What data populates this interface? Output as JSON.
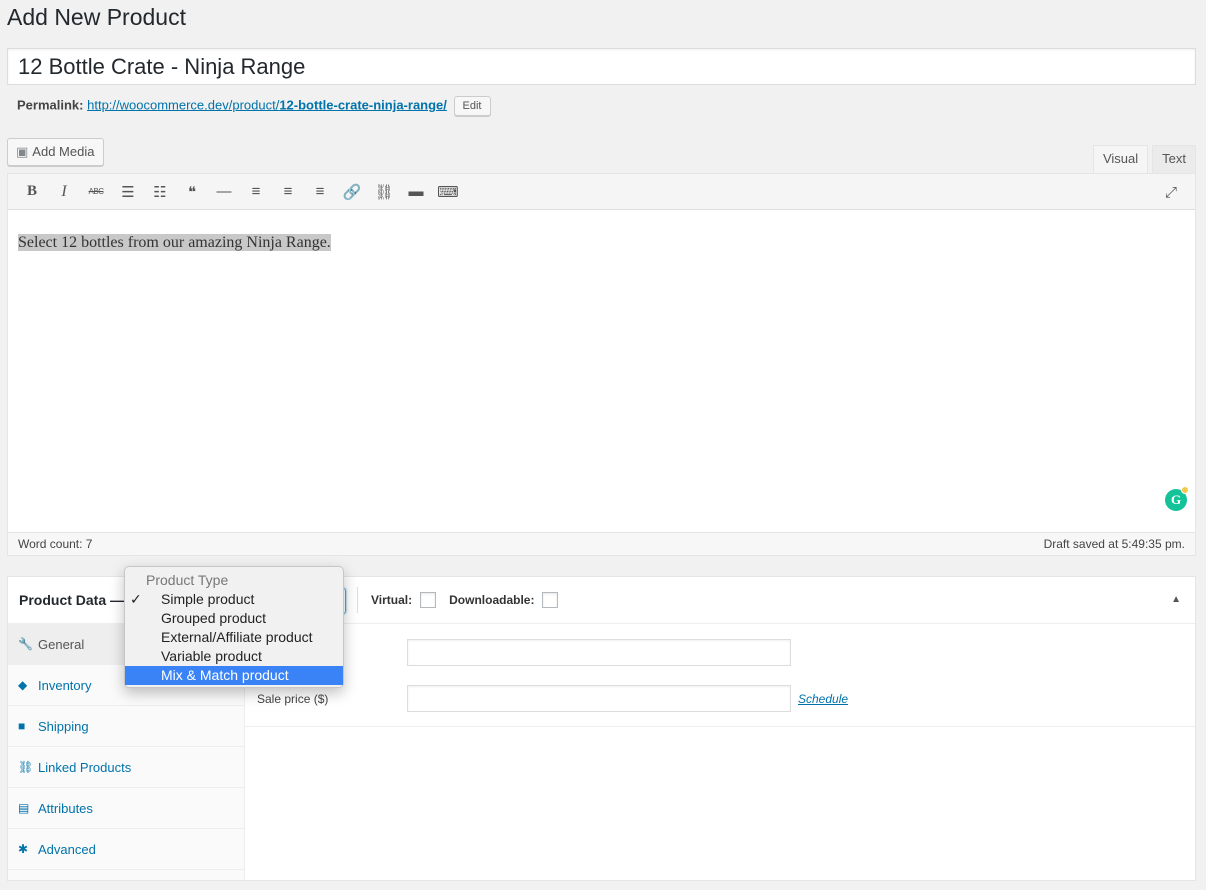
{
  "page": {
    "title": "Add New Product"
  },
  "product": {
    "title_value": "12 Bottle Crate - Ninja Range",
    "permalink_label": "Permalink:",
    "permalink_base": "http://woocommerce.dev/product/",
    "permalink_slug": "12-bottle-crate-ninja-range/",
    "edit_label": "Edit"
  },
  "editor": {
    "add_media_label": "Add Media",
    "tabs": [
      {
        "label": "Visual",
        "active": true
      },
      {
        "label": "Text",
        "active": false
      }
    ],
    "toolbar": [
      {
        "name": "bold-icon",
        "glyph": "B"
      },
      {
        "name": "italic-icon",
        "glyph": "I"
      },
      {
        "name": "strikethrough-icon",
        "glyph": "ABC"
      },
      {
        "name": "bulleted-list-icon",
        "glyph": "☰"
      },
      {
        "name": "numbered-list-icon",
        "glyph": "☷"
      },
      {
        "name": "blockquote-icon",
        "glyph": "❝"
      },
      {
        "name": "horizontal-line-icon",
        "glyph": "—"
      },
      {
        "name": "align-left-icon",
        "glyph": "≡"
      },
      {
        "name": "align-center-icon",
        "glyph": "≡"
      },
      {
        "name": "align-right-icon",
        "glyph": "≡"
      },
      {
        "name": "insert-link-icon",
        "glyph": "🔗"
      },
      {
        "name": "remove-link-icon",
        "glyph": "⛓"
      },
      {
        "name": "read-more-icon",
        "glyph": "▬"
      },
      {
        "name": "toolbar-toggle-icon",
        "glyph": "⌨"
      }
    ],
    "fullscreen_glyph": "⤢",
    "content": "Select 12 bottles from our amazing Ninja Range.",
    "word_count": "Word count: 7",
    "draft_status": "Draft saved at 5:49:35 pm.",
    "grammarly_glyph": "G"
  },
  "product_data": {
    "title": "Product Data —",
    "virtual_label": "Virtual:",
    "downloadable_label": "Downloadable:",
    "collapse_glyph": "▲",
    "tabs": [
      {
        "label": "General",
        "icon": "wrench-icon",
        "glyph": "🔧",
        "active": true
      },
      {
        "label": "Inventory",
        "icon": "tag-icon",
        "glyph": "◆",
        "active": false
      },
      {
        "label": "Shipping",
        "icon": "truck-icon",
        "glyph": "■",
        "active": false
      },
      {
        "label": "Linked Products",
        "icon": "link-icon",
        "glyph": "⛓",
        "active": false
      },
      {
        "label": "Attributes",
        "icon": "list-icon",
        "glyph": "▤",
        "active": false
      },
      {
        "label": "Advanced",
        "icon": "gear-icon",
        "glyph": "✱",
        "active": false
      }
    ],
    "regular_price_label": ")",
    "sale_price_label": "Sale price ($)",
    "schedule_label": "Schedule"
  },
  "product_type_dropdown": {
    "group_label": "Product Type",
    "options": [
      {
        "label": "Simple product",
        "checked": true,
        "highlighted": false
      },
      {
        "label": "Grouped product",
        "checked": false,
        "highlighted": false
      },
      {
        "label": "External/Affiliate product",
        "checked": false,
        "highlighted": false
      },
      {
        "label": "Variable product",
        "checked": false,
        "highlighted": false
      },
      {
        "label": "Mix & Match product",
        "checked": false,
        "highlighted": true
      }
    ],
    "check_glyph": "✓"
  }
}
